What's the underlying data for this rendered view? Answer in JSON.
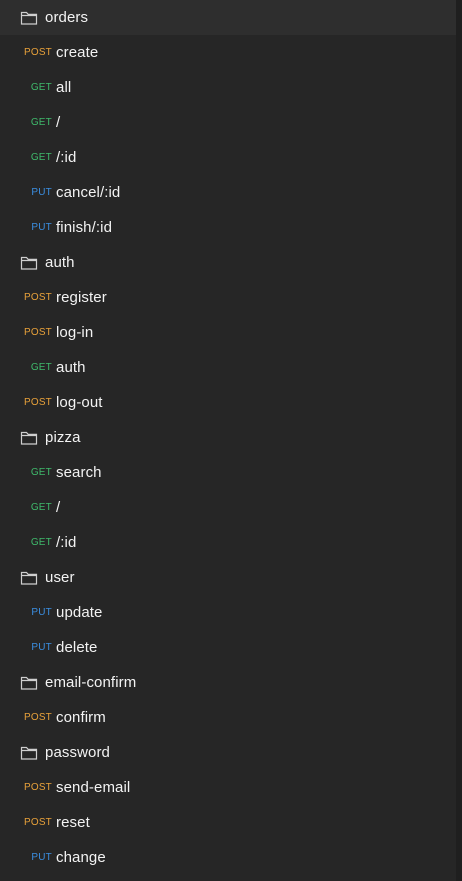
{
  "sidebar": {
    "colors": {
      "background": "#262626",
      "post": "#e8a13a",
      "get": "#3fb86b",
      "put": "#3b8ee0",
      "text": "#f3f3f3"
    },
    "items": [
      {
        "type": "folder",
        "icon": "folder-icon",
        "label": "orders"
      },
      {
        "type": "request",
        "method": "POST",
        "label": "create"
      },
      {
        "type": "request",
        "method": "GET",
        "label": "all"
      },
      {
        "type": "request",
        "method": "GET",
        "label": "/"
      },
      {
        "type": "request",
        "method": "GET",
        "label": "/:id"
      },
      {
        "type": "request",
        "method": "PUT",
        "label": "cancel/:id"
      },
      {
        "type": "request",
        "method": "PUT",
        "label": "finish/:id"
      },
      {
        "type": "folder",
        "icon": "folder-icon",
        "label": "auth"
      },
      {
        "type": "request",
        "method": "POST",
        "label": "register"
      },
      {
        "type": "request",
        "method": "POST",
        "label": "log-in"
      },
      {
        "type": "request",
        "method": "GET",
        "label": "auth"
      },
      {
        "type": "request",
        "method": "POST",
        "label": "log-out"
      },
      {
        "type": "folder",
        "icon": "folder-icon",
        "label": "pizza"
      },
      {
        "type": "request",
        "method": "GET",
        "label": "search"
      },
      {
        "type": "request",
        "method": "GET",
        "label": "/"
      },
      {
        "type": "request",
        "method": "GET",
        "label": "/:id"
      },
      {
        "type": "folder",
        "icon": "folder-icon",
        "label": "user"
      },
      {
        "type": "request",
        "method": "PUT",
        "label": "update"
      },
      {
        "type": "request",
        "method": "PUT",
        "label": "delete"
      },
      {
        "type": "folder",
        "icon": "folder-icon",
        "label": "email-confirm"
      },
      {
        "type": "request",
        "method": "POST",
        "label": "confirm"
      },
      {
        "type": "folder",
        "icon": "folder-icon",
        "label": "password"
      },
      {
        "type": "request",
        "method": "POST",
        "label": "send-email"
      },
      {
        "type": "request",
        "method": "POST",
        "label": "reset"
      },
      {
        "type": "request",
        "method": "PUT",
        "label": "change"
      }
    ]
  }
}
